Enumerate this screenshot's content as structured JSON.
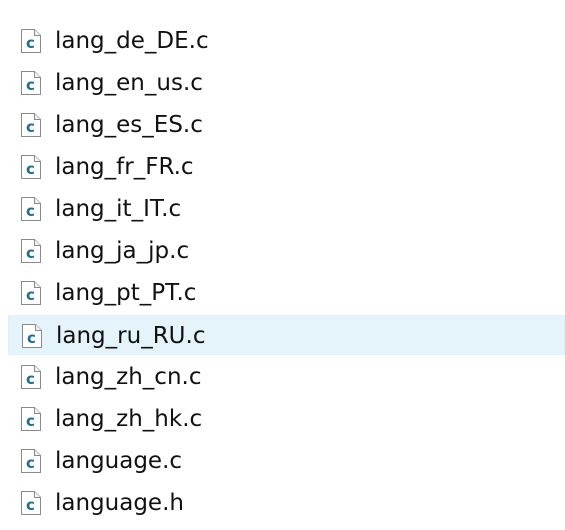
{
  "files": [
    {
      "name": "lang_de_DE.c",
      "icon": "c-source-file-icon"
    },
    {
      "name": "lang_en_us.c",
      "icon": "c-source-file-icon"
    },
    {
      "name": "lang_es_ES.c",
      "icon": "c-source-file-icon"
    },
    {
      "name": "lang_fr_FR.c",
      "icon": "c-source-file-icon"
    },
    {
      "name": "lang_it_IT.c",
      "icon": "c-source-file-icon"
    },
    {
      "name": "lang_ja_jp.c",
      "icon": "c-source-file-icon"
    },
    {
      "name": "lang_pt_PT.c",
      "icon": "c-source-file-icon"
    },
    {
      "name": "lang_ru_RU.c",
      "icon": "c-source-file-icon",
      "selected": true
    },
    {
      "name": "lang_zh_cn.c",
      "icon": "c-source-file-icon"
    },
    {
      "name": "lang_zh_hk.c",
      "icon": "c-source-file-icon"
    },
    {
      "name": "language.c",
      "icon": "c-source-file-icon"
    },
    {
      "name": "language.h",
      "icon": "c-header-file-icon"
    }
  ],
  "colors": {
    "selection_background": "#e5f3fb",
    "icon_letter": "#1e6d8c",
    "text": "#111111"
  }
}
